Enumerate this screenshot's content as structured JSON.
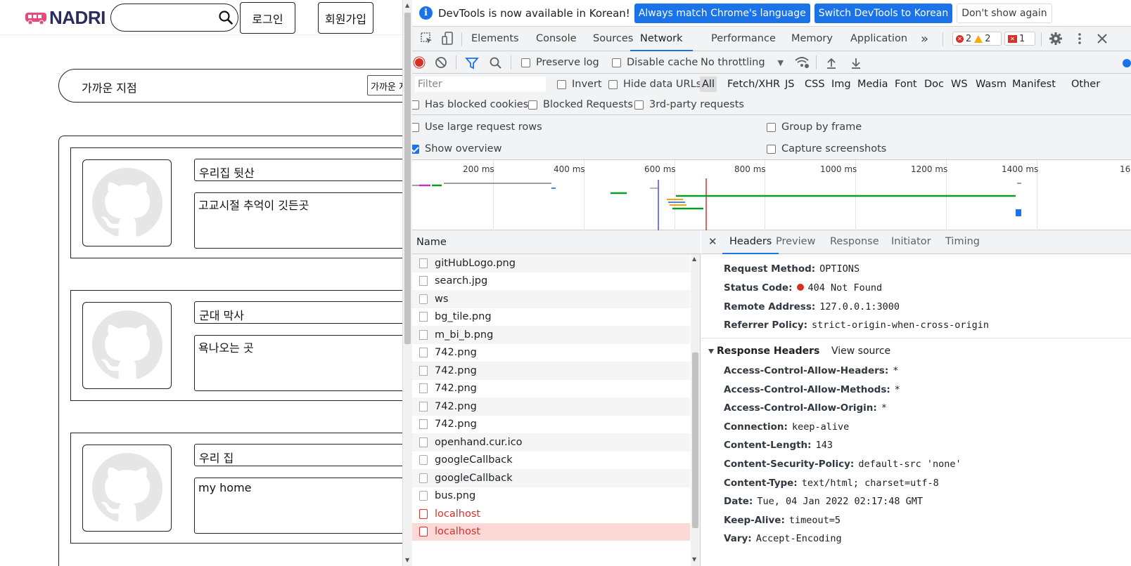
{
  "page": {
    "logo_text": "NADRI",
    "nav": {
      "login": "로그인",
      "signup": "회원가입"
    },
    "branch": {
      "label": "가까운 지점",
      "select_value": "가까운 지점"
    },
    "cards": [
      {
        "title": "우리집 뒷산",
        "desc": "고교시절 추억이 깃든곳"
      },
      {
        "title": "군대 막사",
        "desc": "욕나오는 곳"
      },
      {
        "title": "우리 집",
        "desc": "my home"
      }
    ]
  },
  "devtools": {
    "infobar": {
      "text": "DevTools is now available in Korean!",
      "btn_match": "Always match Chrome's language",
      "btn_switch": "Switch DevTools to Korean",
      "btn_dismiss": "Don't show again"
    },
    "tabs": [
      "Elements",
      "Console",
      "Sources",
      "Network",
      "Performance",
      "Memory",
      "Application"
    ],
    "active_tab": "Network",
    "more": "»",
    "badges": {
      "errors": "2",
      "warnings": "2",
      "issues": "1"
    },
    "toolbar": {
      "preserve_log": "Preserve log",
      "disable_cache": "Disable cache",
      "throttling": "No throttling"
    },
    "filter": {
      "placeholder": "Filter",
      "invert": "Invert",
      "hide_data_urls": "Hide data URLs",
      "types": [
        "All",
        "Fetch/XHR",
        "JS",
        "CSS",
        "Img",
        "Media",
        "Font",
        "Doc",
        "WS",
        "Wasm",
        "Manifest",
        "Other"
      ]
    },
    "blocked": {
      "has_blocked_cookies": "Has blocked cookies",
      "blocked_requests": "Blocked Requests",
      "third_party": "3rd-party requests"
    },
    "settings": {
      "large_rows": "Use large request rows",
      "show_overview": "Show overview",
      "group_by_frame": "Group by frame",
      "capture_screenshots": "Capture screenshots"
    },
    "overview_ticks": [
      "200 ms",
      "400 ms",
      "600 ms",
      "800 ms",
      "1000 ms",
      "1200 ms",
      "1400 ms",
      "16"
    ],
    "name_header": "Name",
    "requests": [
      {
        "name": "gitHubLogo.png",
        "error": false
      },
      {
        "name": "search.jpg",
        "error": false
      },
      {
        "name": "ws",
        "error": false
      },
      {
        "name": "bg_tile.png",
        "error": false
      },
      {
        "name": "m_bi_b.png",
        "error": false
      },
      {
        "name": "742.png",
        "error": false
      },
      {
        "name": "742.png",
        "error": false
      },
      {
        "name": "742.png",
        "error": false
      },
      {
        "name": "742.png",
        "error": false
      },
      {
        "name": "742.png",
        "error": false
      },
      {
        "name": "openhand.cur.ico",
        "error": false
      },
      {
        "name": "googleCallback",
        "error": false
      },
      {
        "name": "googleCallback",
        "error": false
      },
      {
        "name": "bus.png",
        "error": false
      },
      {
        "name": "localhost",
        "error": true
      },
      {
        "name": "localhost",
        "error": true
      }
    ],
    "detail_tabs": [
      "Headers",
      "Preview",
      "Response",
      "Initiator",
      "Timing"
    ],
    "general": {
      "request_method_k": "Request Method:",
      "request_method_v": "OPTIONS",
      "status_code_k": "Status Code:",
      "status_code_v": "404 Not Found",
      "remote_address_k": "Remote Address:",
      "remote_address_v": "127.0.0.1:3000",
      "referrer_policy_k": "Referrer Policy:",
      "referrer_policy_v": "strict-origin-when-cross-origin"
    },
    "response_headers_title": "Response Headers",
    "view_source": "View source",
    "response_headers": [
      {
        "k": "Access-Control-Allow-Headers:",
        "v": "*"
      },
      {
        "k": "Access-Control-Allow-Methods:",
        "v": "*"
      },
      {
        "k": "Access-Control-Allow-Origin:",
        "v": "*"
      },
      {
        "k": "Connection:",
        "v": "keep-alive"
      },
      {
        "k": "Content-Length:",
        "v": "143"
      },
      {
        "k": "Content-Security-Policy:",
        "v": "default-src 'none'"
      },
      {
        "k": "Content-Type:",
        "v": "text/html; charset=utf-8"
      },
      {
        "k": "Date:",
        "v": "Tue, 04 Jan 2022 02:17:48 GMT"
      },
      {
        "k": "Keep-Alive:",
        "v": "timeout=5"
      },
      {
        "k": "Vary:",
        "v": "Accept-Encoding"
      }
    ]
  }
}
